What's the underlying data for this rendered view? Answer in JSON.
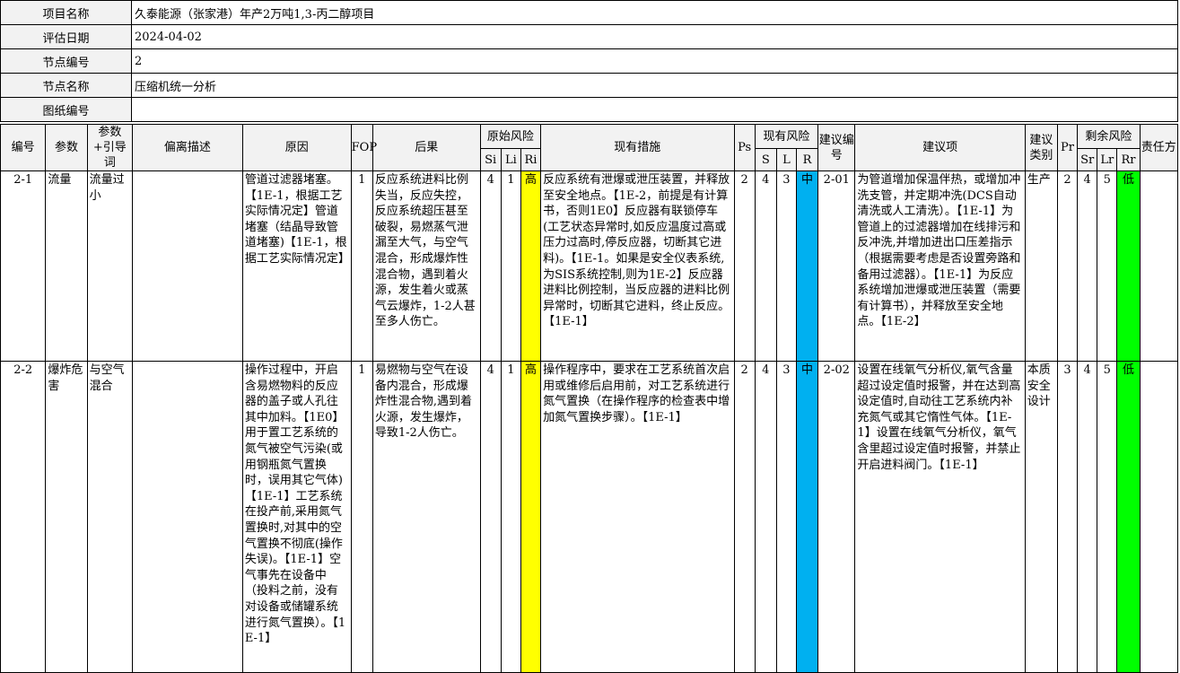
{
  "meta": [
    {
      "label": "项目名称",
      "value": "久泰能源（张家港）年产2万吨1,3-丙二醇项目"
    },
    {
      "label": "评估日期",
      "value": "2024-04-02"
    },
    {
      "label": "节点编号",
      "value": "2"
    },
    {
      "label": "节点名称",
      "value": "压缩机统一分析"
    },
    {
      "label": "图纸编号",
      "value": ""
    }
  ],
  "headers": {
    "no": "编号",
    "param": "参数",
    "guide": "参数+引导词",
    "deviation": "偏离描述",
    "cause": "原因",
    "fop": "FOP",
    "consequence": "后果",
    "orig_risk": "原始风险",
    "si": "Si",
    "li": "Li",
    "ri": "Ri",
    "measures": "现有措施",
    "ps": "Ps",
    "cur_risk": "现有风险",
    "s": "S",
    "l": "L",
    "r": "R",
    "sug_no": "建议编号",
    "suggestion": "建议项",
    "sug_type": "建议类别",
    "pr": "Pr",
    "res_risk": "剩余风险",
    "sr": "Sr",
    "lr": "Lr",
    "rr": "Rr",
    "owner": "责任方"
  },
  "rows": [
    {
      "no": "2-1",
      "param": "流量",
      "guide": "流量过小",
      "deviation": "",
      "cause": "管道过滤器堵塞。【1E-1，根据工艺实际情况定】管道堵塞（结晶导致管道堵塞)【1E-1，根据工艺实际情况定】",
      "fop": "1",
      "consequence": "反应系统进料比例失当，反应失控，反应系统超压甚至破裂，易燃蒸气泄漏至大气，与空气混合，形成爆炸性混合物，遇到着火源，发生着火或蒸气云爆炸，1-2人甚至多人伤亡。",
      "si": "4",
      "li": "1",
      "ri": "高",
      "measures": "反应系统有泄爆或泄压装置，并释放至安全地点。【1E-2，前提是有计算书，否则1E0】反应器有联锁停车(工艺状态异常时,如反应温度过高或压力过高时,停反应器，切断其它进料)。【1E-1。如果是安全仪表系统,为SIS系统控制,则为1E-2】反应器进料比例控制，当反应器的进料比例异常时，切断其它进料，终止反应。【1E-1】",
      "ps": "2",
      "s": "4",
      "l": "3",
      "r": "中",
      "sug_no": "2-01",
      "suggestion": "为管道增加保温伴热，或增加冲洗支管，并定期冲洗(DCS自动清洗或人工清洗）。【1E-1】为管道上的过滤器增加在线排污和反冲洗,并增加进出口压差指示（根据需要考虑是否设置旁路和备用过滤器）。【1E-1】为反应系统增加泄爆或泄压装置（需要有计算书），并释放至安全地点。【1E-2】",
      "sug_type": "生产",
      "pr": "2",
      "sr": "4",
      "lr": "5",
      "rr": "低",
      "owner": ""
    },
    {
      "no": "2-2",
      "param": "爆炸危害",
      "guide": "与空气混合",
      "deviation": "",
      "cause": "操作过程中，开启含易燃物料的反应器的盖子或人孔往其中加料。【1E0】用于置工艺系统的氮气被空气污染(或用钢瓶氮气置换时，误用其它气体)【1E-1】工艺系统在投产前,采用氮气置换时,对其中的空气置换不彻底(操作失误)。【1E-1】空气事先在设备中（投料之前，没有对设备或储罐系统进行氮气置换）。【1E-1】",
      "fop": "1",
      "consequence": "易燃物与空气在设备内混合，形成爆炸性混合物,遇到着火源，发生爆炸，导致1-2人伤亡。",
      "si": "4",
      "li": "1",
      "ri": "高",
      "measures": "操作程序中，要求在工艺系统首次启用或维修后启用前，对工艺系统进行氮气置换（在操作程序的检查表中增加氮气置换步骤）。【1E-1】",
      "ps": "2",
      "s": "4",
      "l": "3",
      "r": "中",
      "sug_no": "2-02",
      "suggestion": "设置在线氧气分析仪,氧气含量超过设定值时报警，并在达到高设定值时,自动往工艺系统内补充氮气或其它惰性气体。【1E-1】设置在线氧气分析仪，氧气含里超过设定值时报警，并禁止开启进料阀门。【1E-1】",
      "sug_type": "本质安全设计",
      "pr": "3",
      "sr": "4",
      "lr": "5",
      "rr": "低",
      "owner": ""
    }
  ],
  "colors": {
    "high": "#ffff00",
    "medium": "#00b0f0",
    "low": "#00ff00",
    "header_bg": "#f2f2f2"
  }
}
